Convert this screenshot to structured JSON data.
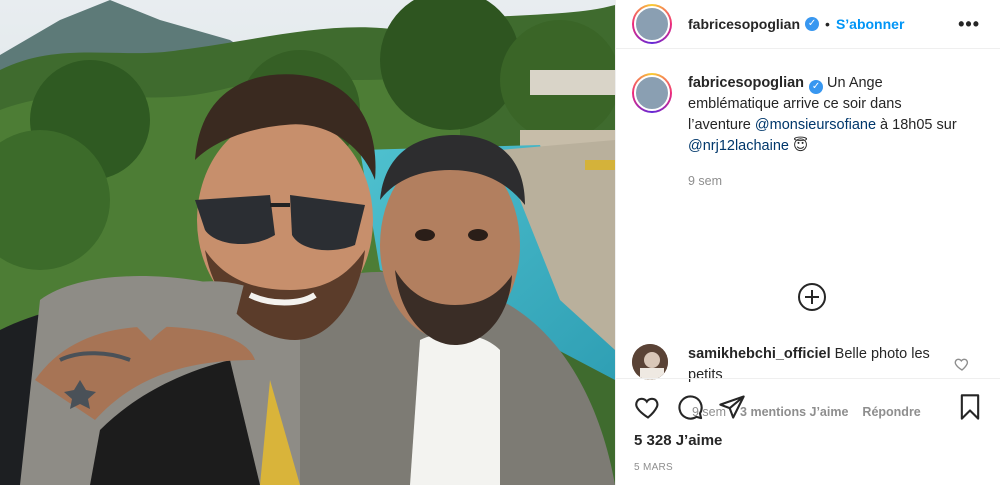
{
  "header": {
    "username": "fabricesopoglian",
    "separator": "•",
    "follow_label": "S’abonner",
    "more_label": "•••"
  },
  "caption": {
    "username": "fabricesopoglian",
    "text_before": " Un Ange emblématique arrive ce soir dans l’aventure ",
    "mention_1": "@monsieursofiane",
    "text_middle": " à 18h05 sur ",
    "mention_2": "@nrj12lachaine",
    "emoji": " 😇",
    "time": "9 sem"
  },
  "comment": {
    "username": "samikhebchi_officiel",
    "text": " Belle photo les petits",
    "time": "9 sem",
    "likes_label": "3 mentions J’aime",
    "reply_label": "Répondre"
  },
  "actions": {
    "likes": "5 328 J’aime",
    "date": "5 MARS"
  },
  "colors": {
    "link": "#0095f6",
    "verified": "#3897f0",
    "muted": "#8e8e8e"
  }
}
